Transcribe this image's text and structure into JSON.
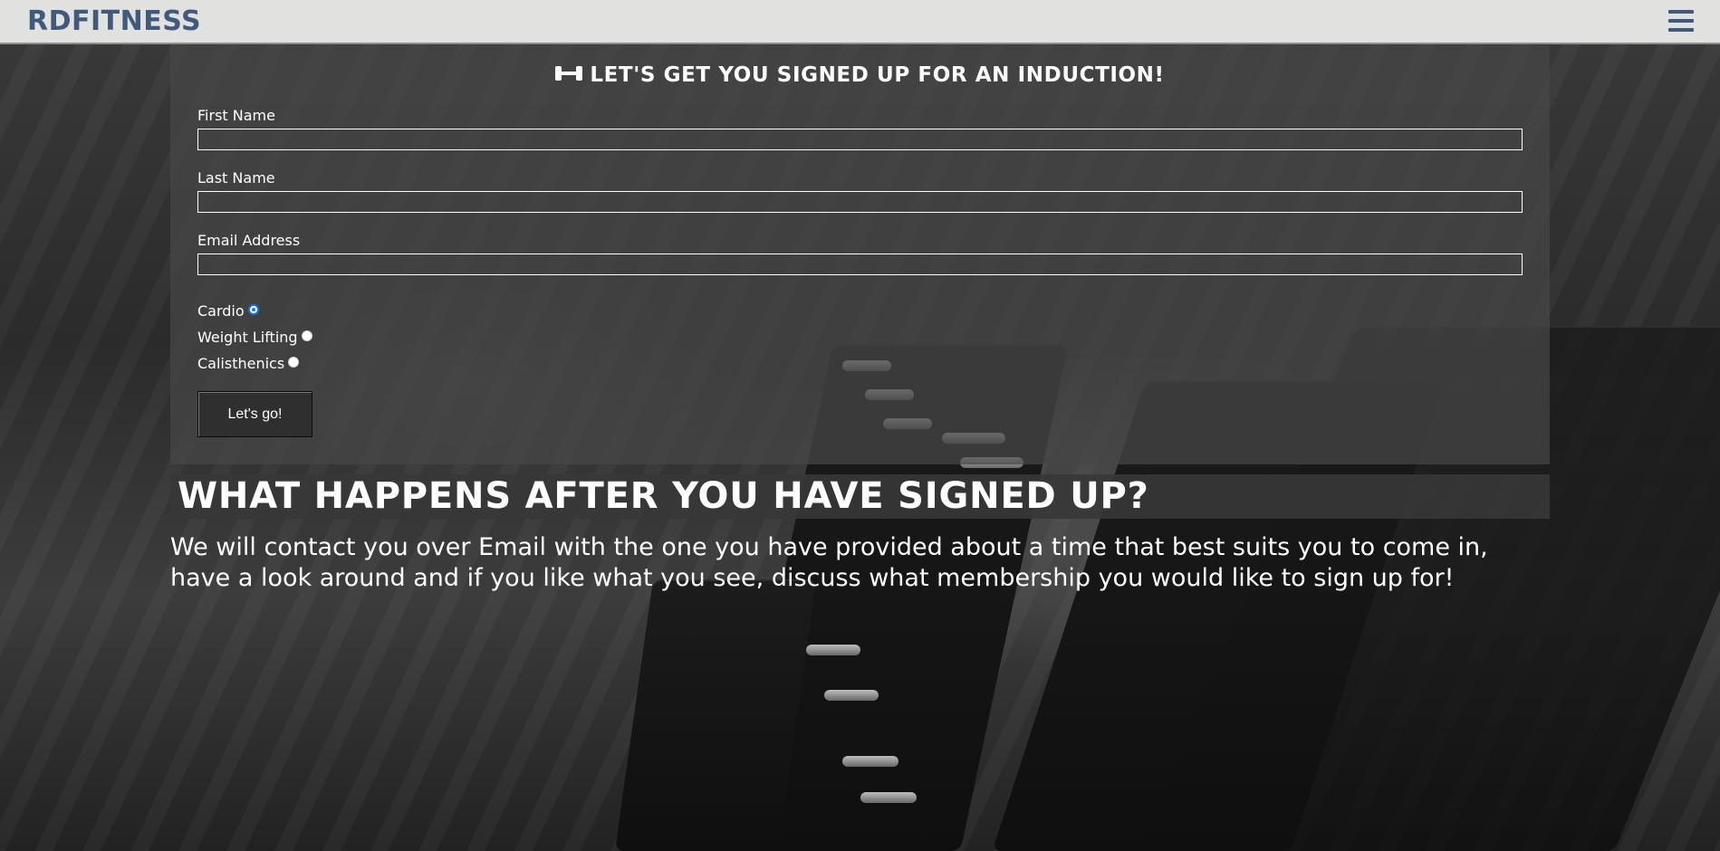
{
  "navbar": {
    "brand": "RDFITNESS",
    "menu_icon": "hamburger-menu-icon",
    "brand_color": "#3f5a7c"
  },
  "form": {
    "title": "LET'S GET YOU SIGNED UP FOR AN INDUCTION!",
    "title_icon": "dumbbell-icon",
    "fields": [
      {
        "label": "First Name",
        "value": "",
        "placeholder": ""
      },
      {
        "label": "Last Name",
        "value": "",
        "placeholder": ""
      },
      {
        "label": "Email Address",
        "value": "",
        "placeholder": ""
      }
    ],
    "options": [
      {
        "label": "Cardio",
        "selected": true
      },
      {
        "label": "Weight Lifting",
        "selected": false
      },
      {
        "label": "Calisthenics",
        "selected": false
      }
    ],
    "submit_label": "Let's go!"
  },
  "info": {
    "heading": "WHAT HAPPENS AFTER YOU HAVE SIGNED UP?",
    "text": "We will contact you over Email with the one you have provided about a time that best suits you to come in, have a look around and if you like what you see, discuss what membership you would like to sign up for!"
  }
}
